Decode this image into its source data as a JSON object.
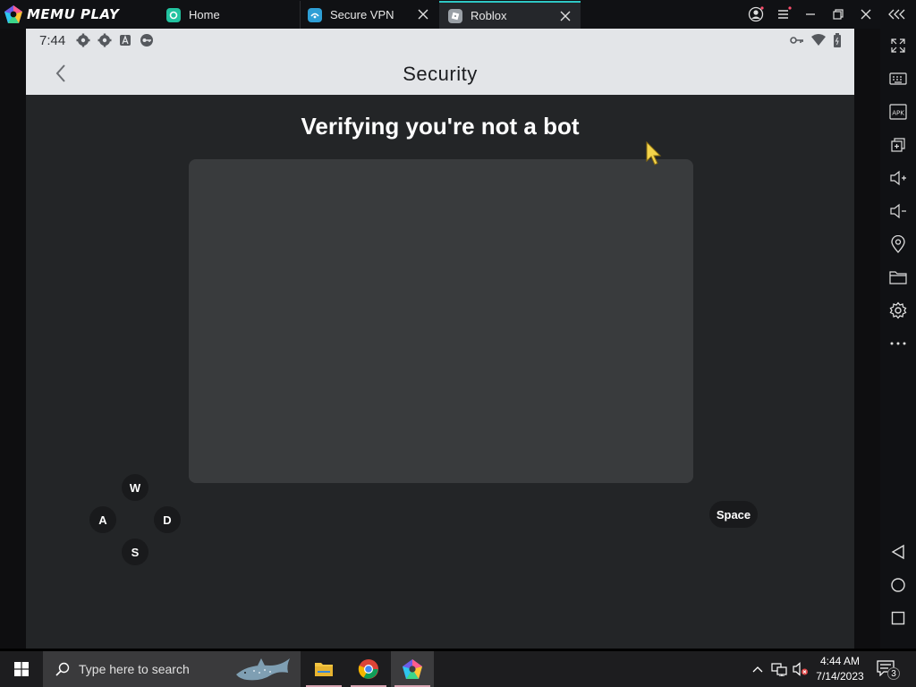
{
  "colors": {
    "accent_tab": "#2ec7c4",
    "screen_bg": "#232527",
    "captcha_bg": "#393b3d",
    "appbar_bg": "#e3e5e8",
    "cursor": "#f3d34a"
  },
  "titlebar": {
    "brand": "MEMU PLAY",
    "tabs": [
      {
        "label": "Home",
        "icon": "memu-home-icon",
        "active": false,
        "closable": false
      },
      {
        "label": "Secure VPN",
        "icon": "vpn-app-icon",
        "active": false,
        "closable": true
      },
      {
        "label": "Roblox",
        "icon": "roblox-icon",
        "active": true,
        "closable": true
      }
    ],
    "buttons": [
      "account-icon",
      "menu-icon",
      "minimize-icon",
      "restore-icon",
      "close-icon",
      "collapse-sidebar-icon"
    ]
  },
  "android": {
    "status_time": "7:44",
    "status_icons": [
      "settings-icon",
      "settings-icon",
      "a-badge-icon",
      "vpn-key-icon"
    ],
    "status_right_icons": [
      "key-icon",
      "wifi-icon",
      "battery-icon"
    ],
    "appbar_title": "Security",
    "verify_title": "Verifying you're not a bot"
  },
  "keymap": {
    "up": "W",
    "left": "A",
    "right": "D",
    "down": "S",
    "jump": "Space"
  },
  "sidebar": {
    "buttons": [
      "fullscreen-icon",
      "keyboard-icon",
      "apk-icon",
      "multi-window-icon",
      "volume-up-icon",
      "volume-down-icon",
      "location-icon",
      "folder-icon",
      "settings-icon",
      "more-icon",
      "android-back-icon",
      "android-home-icon",
      "android-recents-icon"
    ],
    "apk_label": "APK"
  },
  "taskbar": {
    "search_placeholder": "Type here to search",
    "apps": [
      "file-explorer-icon",
      "chrome-icon",
      "memu-icon"
    ],
    "time": "4:44 AM",
    "date": "7/14/2023",
    "notification_count": "3"
  }
}
